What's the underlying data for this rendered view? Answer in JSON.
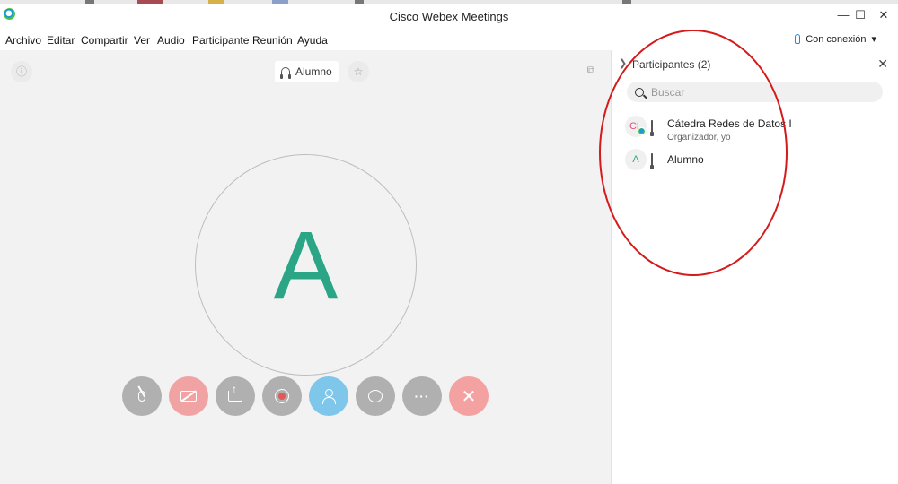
{
  "window": {
    "title": "Cisco Webex Meetings",
    "minimize": "—",
    "maximize": "☐",
    "close": "✕"
  },
  "menu": [
    "Archivo",
    "Editar",
    "Compartir",
    "Ver",
    "Audio",
    "Participante",
    "Reunión",
    "Ayuda"
  ],
  "connection": {
    "label": "Con conexión",
    "caret": "▾"
  },
  "stage": {
    "info_icon": "ⓘ",
    "active_speaker": "Alumno",
    "pin_icon": "☆",
    "layout_icon": "⧉",
    "avatar_letter": "A"
  },
  "controls": {
    "more_label": "···",
    "leave_label": "✕"
  },
  "participants_panel": {
    "collapse_icon": "❯",
    "title": "Participantes (2)",
    "close_icon": "✕",
    "search_placeholder": "Buscar",
    "items": [
      {
        "initials": "CL",
        "name": "Cátedra Redes de Datos I",
        "role": "Organizador, yo"
      },
      {
        "initials": "A",
        "name": "Alumno",
        "role": ""
      }
    ]
  },
  "colors": {
    "avatar_letter": "#2aa586",
    "leave_button": "#f4a1a1",
    "video_button": "#f1a3a3",
    "participants_button": "#7ec7ea",
    "annotation_circle": "#d51a1a"
  }
}
